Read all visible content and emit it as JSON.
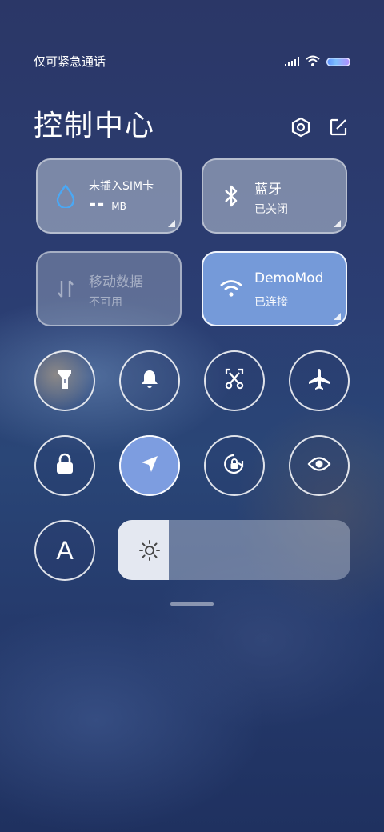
{
  "status": {
    "carrier": "仅可紧急通话",
    "icons": [
      "signal-icon",
      "wifi-icon",
      "battery-icon"
    ]
  },
  "header": {
    "title": "控制中心",
    "settings_icon": "settings-icon",
    "edit_icon": "edit-icon"
  },
  "tiles": [
    {
      "name": "data-usage",
      "icon": "water-drop-icon",
      "title": "未插入SIM卡",
      "value": "--",
      "unit": "MB",
      "state": "normal"
    },
    {
      "name": "bluetooth",
      "icon": "bluetooth-icon",
      "title": "蓝牙",
      "subtitle": "已关闭",
      "state": "normal"
    },
    {
      "name": "mobile-data",
      "icon": "mobile-data-icon",
      "title": "移动数据",
      "subtitle": "不可用",
      "state": "disabled"
    },
    {
      "name": "wifi",
      "icon": "wifi-icon",
      "title": "DemoMod",
      "subtitle": "已连接",
      "state": "on"
    }
  ],
  "toggles": [
    {
      "name": "flashlight",
      "icon": "flashlight-icon",
      "on": false
    },
    {
      "name": "mute",
      "icon": "bell-icon",
      "on": false
    },
    {
      "name": "screenshot",
      "icon": "screenshot-icon",
      "on": false
    },
    {
      "name": "airplane-mode",
      "icon": "airplane-icon",
      "on": false
    },
    {
      "name": "lock-screen",
      "icon": "lock-icon",
      "on": false
    },
    {
      "name": "location",
      "icon": "location-arrow-icon",
      "on": true
    },
    {
      "name": "rotation-lock",
      "icon": "rotation-lock-icon",
      "on": false
    },
    {
      "name": "reading-mode",
      "icon": "eye-icon",
      "on": false
    }
  ],
  "font_toggle": {
    "label": "A"
  },
  "brightness": {
    "icon": "sun-icon",
    "level": 0.22
  },
  "colors": {
    "accent": "#7d9de0",
    "tile_on": "#82aaeb"
  }
}
